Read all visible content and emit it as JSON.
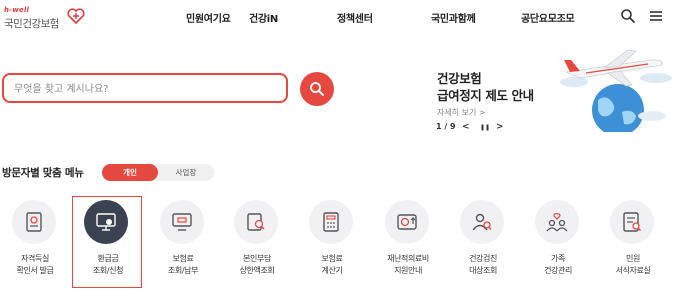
{
  "header": {
    "logo_small": "h-well",
    "logo_name": "국민건강보험",
    "nav": [
      "민원여기요",
      "건강iN",
      "정책센터",
      "국민과함께",
      "공단요모조모"
    ],
    "search_icon": "search-icon",
    "menu_icon": "hamburger-menu-icon"
  },
  "search": {
    "placeholder": "무엇을 찾고 계시나요?",
    "button_icon": "search-icon"
  },
  "banner": {
    "title_line1": "건강보험",
    "title_line2": "급여정지 제도 안내",
    "more": "자세히 보기 >",
    "page": "1 / 9",
    "prev": "<",
    "pause": "❚❚",
    "next": ">"
  },
  "menu": {
    "title": "방문자별 맞춤 메뉴",
    "tabs": [
      "개인",
      "사업장"
    ],
    "items": [
      {
        "line1": "자격득실",
        "line2": "확인서 발급",
        "icon": "certificate-icon"
      },
      {
        "line1": "환급금",
        "line2": "조회/신청",
        "icon": "monitor-refund-icon"
      },
      {
        "line1": "보험료",
        "line2": "조회/납부",
        "icon": "computer-payment-icon"
      },
      {
        "line1": "본인부담",
        "line2": "상한액조회",
        "icon": "document-search-icon"
      },
      {
        "line1": "보험료",
        "line2": "계산기",
        "icon": "calculator-icon"
      },
      {
        "line1": "재난적의료비",
        "line2": "지원안내",
        "icon": "medical-support-icon"
      },
      {
        "line1": "건강검진",
        "line2": "대상조회",
        "icon": "person-search-icon"
      },
      {
        "line1": "가족",
        "line2": "건강관리",
        "icon": "family-icon"
      },
      {
        "line1": "민원",
        "line2": "서식자료실",
        "icon": "form-document-icon"
      }
    ]
  },
  "colors": {
    "accent": "#e5483f",
    "active_icon_bg": "#3b4252"
  }
}
